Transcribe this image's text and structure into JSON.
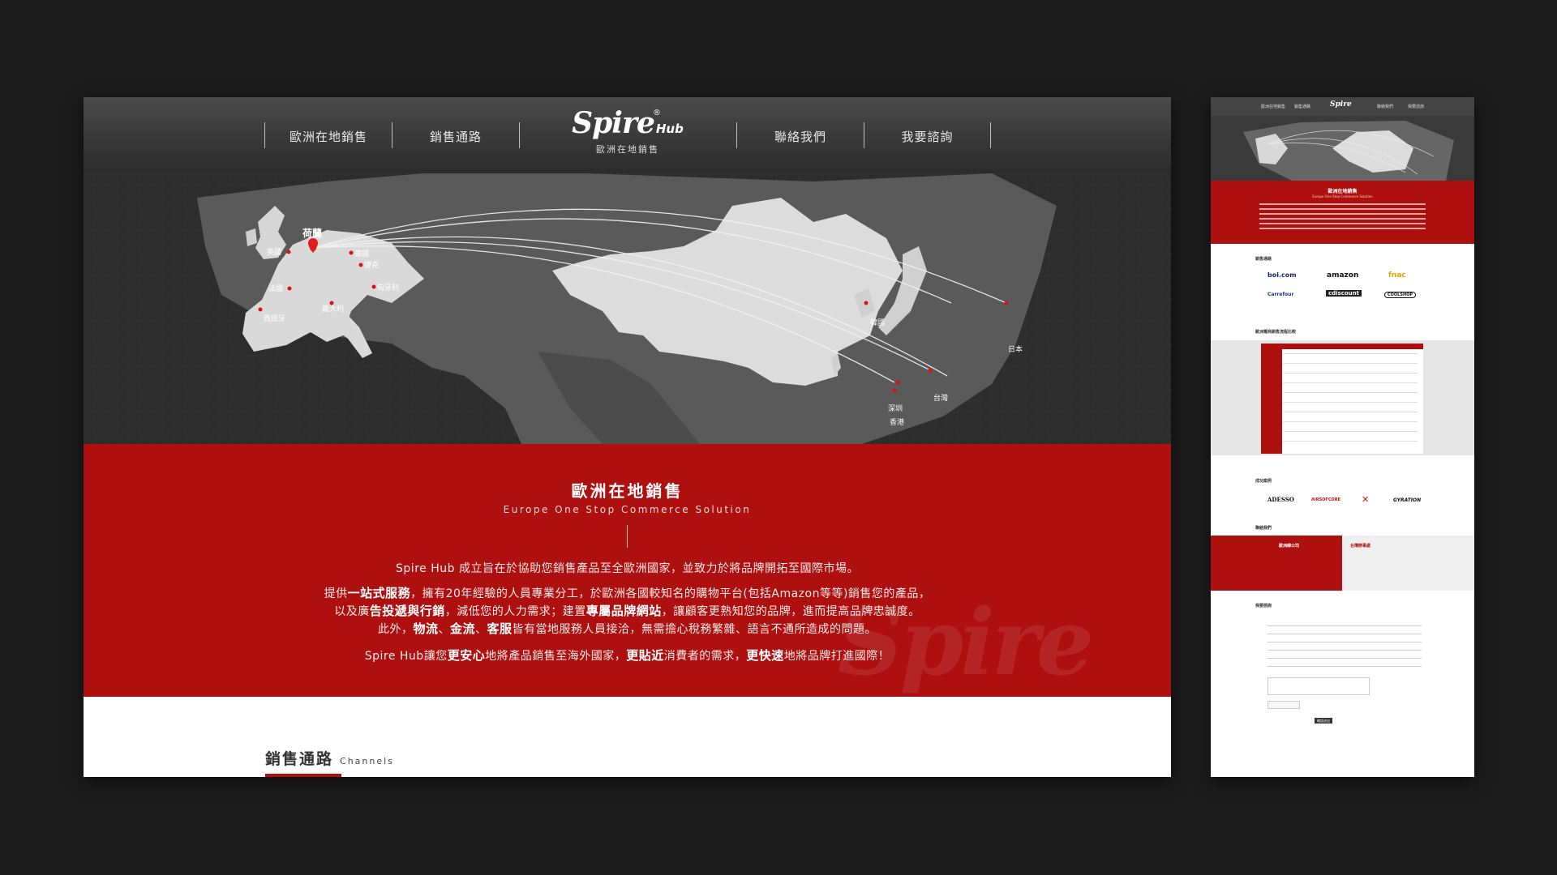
{
  "nav": {
    "items": [
      "歐洲在地銷售",
      "銷售通路",
      "聯絡我們",
      "我要諮詢"
    ],
    "logo_word": "Spire",
    "logo_hub": "Hub",
    "logo_reg": "®",
    "logo_sub": "歐洲在地銷售"
  },
  "map": {
    "europe_labels": [
      "荷蘭",
      "英國",
      "德國",
      "捷克",
      "法國",
      "匈牙利",
      "義大利",
      "西班牙"
    ],
    "asia_labels": [
      "韓國",
      "日本",
      "深圳",
      "香港",
      "台灣"
    ]
  },
  "intro": {
    "title": "歐洲在地銷售",
    "subtitle": "Europe One Stop Commerce Solution",
    "line1": "Spire Hub 成立旨在於協助您銷售產品至全歐洲國家，並致力於將品牌開拓至國際市場。",
    "line2_a": "提供",
    "line2_b": "一站式服務",
    "line2_c": "，擁有20年經驗的人員專業分工，於歐洲各國較知名的購物平台(包括Amazon等等)銷售您的產品，",
    "line3_a": "以及廣",
    "line3_b": "告投遞與行銷",
    "line3_c": "，減低您的人力需求；建置",
    "line3_d": "專屬品牌網站",
    "line3_e": "，讓顧客更熟知您的品牌，進而提高品牌忠誠度。",
    "line4_a": "此外，",
    "line4_b": "物流",
    "line4_c": "、",
    "line4_d": "金流",
    "line4_e": "、",
    "line4_f": "客服",
    "line4_g": "皆有當地服務人員接洽，無需擔心稅務繁雜、語言不通所造成的問題。",
    "line5_a": "Spire Hub讓您",
    "line5_b": "更安心",
    "line5_c": "地將產品銷售至海外國家，",
    "line5_d": "更貼近",
    "line5_e": "消費者的需求，",
    "line5_f": "更快速",
    "line5_g": "地將品牌打進國際！",
    "watermark": "Spire"
  },
  "channels": {
    "title": "銷售通路",
    "subtitle": "Channels"
  },
  "side": {
    "nav": [
      "歐洲在地銷售",
      "銷售通路",
      "聯絡我們",
      "我要諮詢"
    ],
    "intro_title": "歐洲在地銷售",
    "intro_sub": "Europe One Stop Commerce Solution",
    "channels_title": "銷售通路",
    "channel_logos": [
      "bol.com",
      "amazon",
      "fnac",
      "Carrefour",
      "cdiscount",
      "COOLSHOP"
    ],
    "table_title": "歐洲電商銷售流程比較",
    "clients_title": "成功案例",
    "client_logos": [
      "ADESSO",
      "AIRSOFCORE",
      "✕",
      "GYRATION"
    ],
    "contact_title": "聯絡我們",
    "office_left": "歐洲總公司",
    "office_right": "台灣辦事處",
    "form_title": "我要諮詢",
    "submit": "確認送出"
  },
  "colors": {
    "red": "#ae0f0f",
    "dark": "#2f2f2f",
    "bg": "#1c1c1c"
  }
}
